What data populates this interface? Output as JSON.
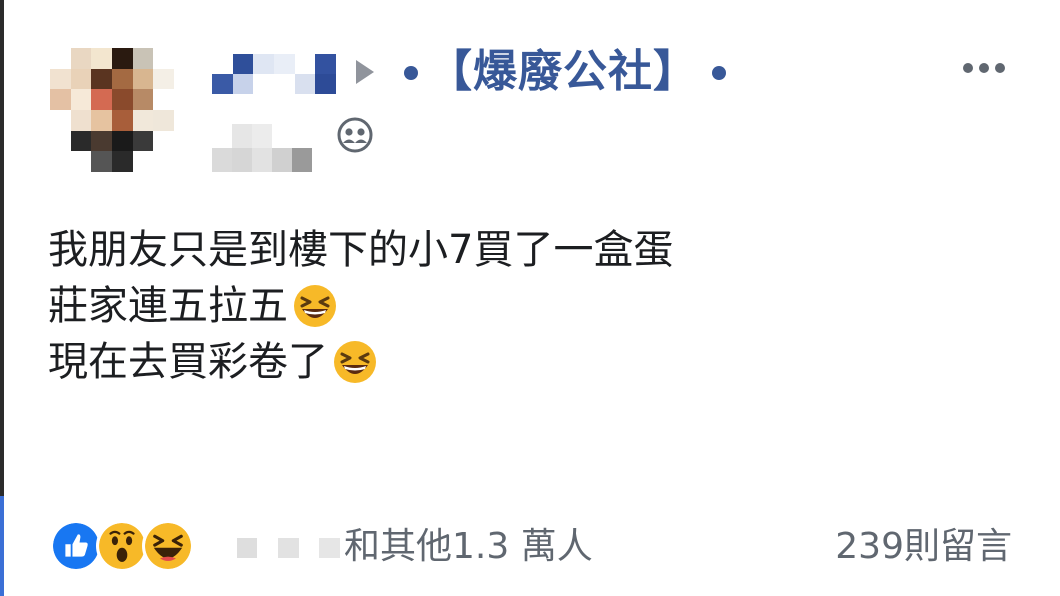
{
  "header": {
    "group_name": "【爆廢公社】",
    "more_icon": "more-horizontal-icon",
    "privacy_icon": "group-members-icon"
  },
  "post": {
    "lines": [
      {
        "text": "我朋友只是到樓下的小7買了一盒蛋",
        "emoji": null
      },
      {
        "text": "莊家連五拉五",
        "emoji": "grinning-squinting-face"
      },
      {
        "text": "現在去買彩卷了",
        "emoji": "grinning-squinting-face"
      }
    ]
  },
  "footer": {
    "reactions": [
      "like",
      "wow",
      "haha"
    ],
    "reaction_summary": "和其他1.3 萬人",
    "comments": "239則留言"
  },
  "colors": {
    "link": "#385898",
    "secondary_text": "#606770",
    "like_blue": "#1877f2",
    "emoji_yellow": "#f7b928"
  }
}
